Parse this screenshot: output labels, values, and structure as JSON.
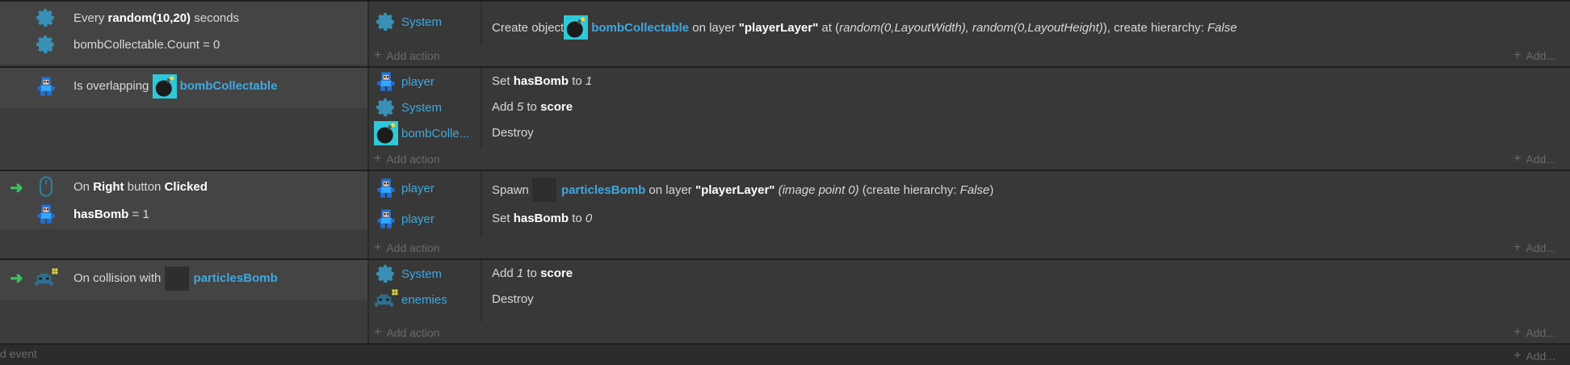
{
  "labels": {
    "add_action": "Add action",
    "add_more": "Add...",
    "add_event": "d event"
  },
  "colors": {
    "object_link": "#3ea8e0",
    "trigger_arrow": "#3bc15a",
    "bomb_bg": "#2fc9d9"
  },
  "events": [
    {
      "conditions": [
        {
          "icon": "gear-icon",
          "pre": "Every ",
          "bold": "random(10,20)",
          "post": " seconds"
        },
        {
          "icon": "gear-icon",
          "pre": "bombCollectable.Count = 0"
        }
      ],
      "actions": [
        {
          "object": "System",
          "icon": "gear-icon",
          "pre": "Create object ",
          "link": "bombCollectable",
          "mid": " on layer ",
          "bold": "\"playerLayer\"",
          "mid2": " at (",
          "ital": "random(0,LayoutWidth), random(0,LayoutHeight)",
          "post": "), create hierarchy: ",
          "ital2": "False"
        }
      ]
    },
    {
      "conditions": [
        {
          "icon": "player-icon",
          "pre": "Is overlapping ",
          "link": "bombCollectable"
        }
      ],
      "actions": [
        {
          "object": "player",
          "pre": "Set ",
          "bold": "hasBomb",
          "mid": " to ",
          "ital": "1"
        },
        {
          "object": "System",
          "pre": "Add ",
          "ital": "5",
          "mid": " to ",
          "bold": "score"
        },
        {
          "object": "bombColle...",
          "pre": "Destroy"
        }
      ]
    },
    {
      "conditions": [
        {
          "icon": "mouse-icon",
          "pre": "On ",
          "bold": "Right",
          "mid": " button ",
          "bold2": "Clicked"
        },
        {
          "icon": "player-icon",
          "bold": "hasBomb",
          "post": " = 1"
        }
      ],
      "actions": [
        {
          "object": "player",
          "pre": "Spawn ",
          "link": "particlesBomb",
          "mid": " on layer ",
          "bold": "\"playerLayer\"",
          "ital": " (image point 0)",
          "post": " (create hierarchy: ",
          "ital2": "False",
          "post2": ")"
        },
        {
          "object": "player",
          "pre": "Set ",
          "bold": "hasBomb",
          "mid": " to ",
          "ital": "0"
        }
      ]
    },
    {
      "conditions": [
        {
          "icon": "enemy-icon",
          "pre": "On collision with ",
          "link": "particlesBomb"
        }
      ],
      "actions": [
        {
          "object": "System",
          "pre": "Add ",
          "ital": "1",
          "mid": " to ",
          "bold": "score"
        },
        {
          "object": "enemies",
          "pre": "Destroy"
        }
      ]
    }
  ]
}
